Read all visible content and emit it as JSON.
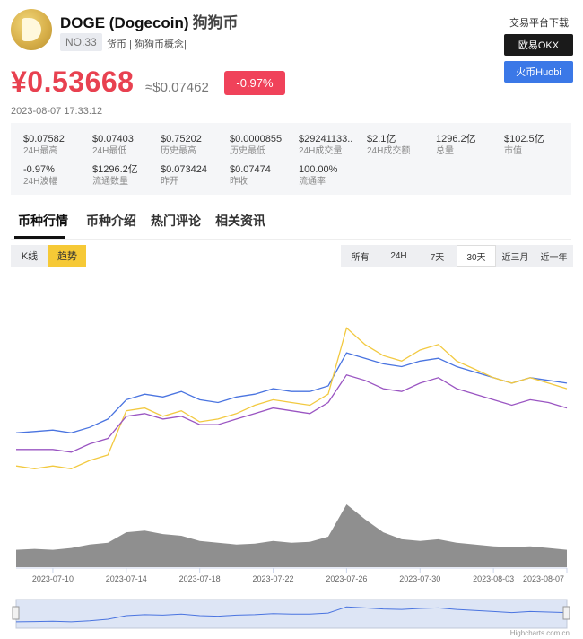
{
  "coin": {
    "symbol_name": "DOGE (Dogecoin)",
    "cn_name": "狗狗币",
    "rank": "NO.33",
    "tags": "货币 | 狗狗币概念|"
  },
  "exchange": {
    "title": "交易平台下载",
    "okx": "欧易OKX",
    "huobi": "火币Huobi"
  },
  "price": {
    "cny": "¥0.53668",
    "usd": "≈$0.07462",
    "change": "-0.97%",
    "time": "2023-08-07 17:33:12"
  },
  "stats": [
    {
      "value": "$0.07582",
      "label": "24H最高"
    },
    {
      "value": "$0.07403",
      "label": "24H最低"
    },
    {
      "value": "$0.75202",
      "label": "历史最高"
    },
    {
      "value": "$0.0000855",
      "label": "历史最低"
    },
    {
      "value": "$29241133...",
      "label": "24H成交量"
    },
    {
      "value": "$2.1亿",
      "label": "24H成交额"
    },
    {
      "value": "1296.2亿",
      "label": "总量"
    },
    {
      "value": "$102.5亿",
      "label": "市值"
    },
    {
      "value": "-0.97%",
      "label": "24H波幅"
    },
    {
      "value": "$1296.2亿",
      "label": "流通数量"
    },
    {
      "value": "$0.073424",
      "label": "昨开"
    },
    {
      "value": "$0.07474",
      "label": "昨收"
    },
    {
      "value": "100.00%",
      "label": "流通率"
    }
  ],
  "tabs": [
    "币种行情",
    "币种介绍",
    "热门评论",
    "相关资讯"
  ],
  "chart_mode": {
    "kline": "K线",
    "trend": "趋势"
  },
  "ranges": [
    "所有",
    "24H",
    "7天",
    "30天",
    "近三月",
    "近一年"
  ],
  "selected_range": "30天",
  "chart_data": {
    "type": "line",
    "x_ticks": [
      "2023-07-10",
      "2023-07-14",
      "2023-07-18",
      "2023-07-22",
      "2023-07-26",
      "2023-07-30",
      "2023-08-03",
      "2023-08-07"
    ],
    "x": [
      "07-08",
      "07-09",
      "07-10",
      "07-11",
      "07-12",
      "07-13",
      "07-14",
      "07-15",
      "07-16",
      "07-17",
      "07-18",
      "07-19",
      "07-20",
      "07-21",
      "07-22",
      "07-23",
      "07-24",
      "07-25",
      "07-26",
      "07-27",
      "07-28",
      "07-29",
      "07-30",
      "07-31",
      "08-01",
      "08-02",
      "08-03",
      "08-04",
      "08-05",
      "08-06",
      "08-07"
    ],
    "series": [
      {
        "color": "#4a74e0",
        "values": [
          42,
          42.5,
          43,
          42,
          44,
          47,
          54,
          56,
          55,
          57,
          54,
          53,
          55,
          56,
          58,
          57,
          57,
          59,
          71,
          69,
          67,
          66,
          68,
          69,
          66,
          64,
          62,
          60,
          62,
          61,
          60
        ]
      },
      {
        "color": "#f2c940",
        "values": [
          30,
          29,
          30,
          29,
          32,
          34,
          50,
          51,
          48,
          50,
          46,
          47,
          49,
          52,
          54,
          53,
          52,
          56,
          80,
          74,
          70,
          68,
          72,
          74,
          68,
          65,
          62,
          60,
          62,
          60,
          58
        ]
      },
      {
        "color": "#9a55c2",
        "values": [
          36,
          36,
          36,
          35,
          38,
          40,
          48,
          49,
          47,
          48,
          45,
          45,
          47,
          49,
          51,
          50,
          49,
          53,
          63,
          61,
          58,
          57,
          60,
          62,
          58,
          56,
          54,
          52,
          54,
          53,
          51
        ]
      }
    ],
    "volume": [
      20,
      21,
      20,
      22,
      26,
      28,
      40,
      42,
      38,
      36,
      30,
      28,
      26,
      27,
      30,
      28,
      29,
      35,
      72,
      55,
      40,
      32,
      30,
      32,
      28,
      26,
      24,
      23,
      24,
      22,
      20
    ],
    "grid": false,
    "credit": "Highcharts.com.cn"
  }
}
